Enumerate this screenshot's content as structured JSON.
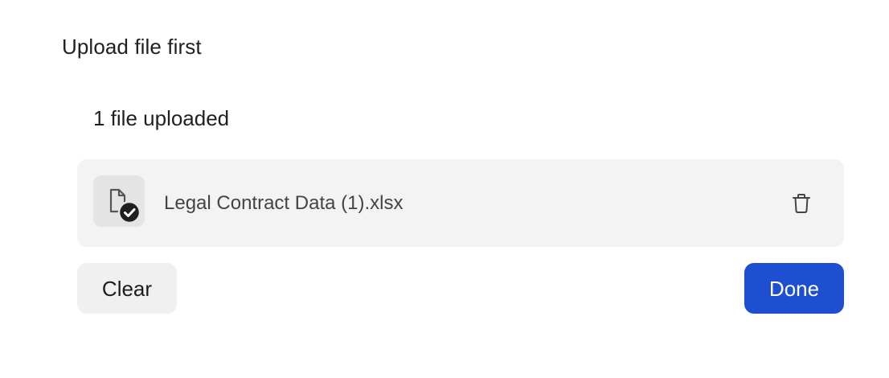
{
  "header": {
    "title": "Upload file first"
  },
  "uploads": {
    "count_label": "1 file uploaded",
    "files": [
      {
        "name": "Legal Contract Data (1).xlsx",
        "status": "uploaded",
        "file_icon": "document-check-icon",
        "delete_icon": "trash-icon"
      }
    ]
  },
  "actions": {
    "clear_label": "Clear",
    "done_label": "Done"
  },
  "colors": {
    "primary": "#1f4fd1",
    "card_background": "#f3f3f3",
    "secondary_button": "#f0f0f0"
  }
}
